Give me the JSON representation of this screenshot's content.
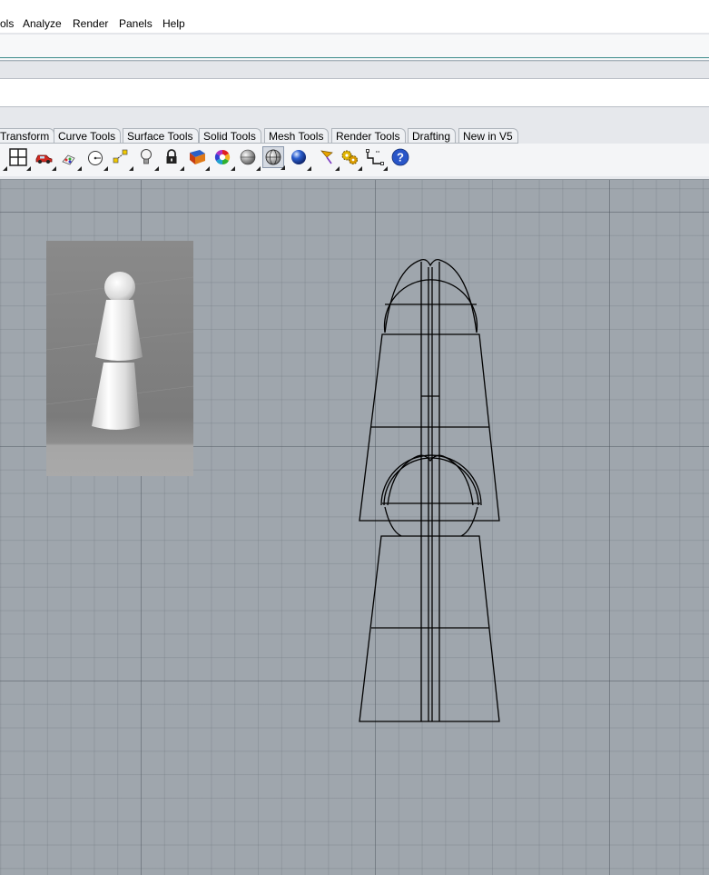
{
  "menu": {
    "items": [
      {
        "label": "ols"
      },
      {
        "label": "Analyze"
      },
      {
        "label": "Render"
      },
      {
        "label": "Panels"
      },
      {
        "label": "Help"
      }
    ]
  },
  "command": {
    "prompt_value": ""
  },
  "tabs": [
    {
      "label": "Transform"
    },
    {
      "label": "Curve Tools"
    },
    {
      "label": "Surface Tools"
    },
    {
      "label": "Solid Tools"
    },
    {
      "label": "Mesh Tools"
    },
    {
      "label": "Render Tools"
    },
    {
      "label": "Drafting"
    },
    {
      "label": "New in V5"
    }
  ],
  "toolbar": {
    "buttons": [
      {
        "icon": "viewport-layout-icon"
      },
      {
        "icon": "car-icon"
      },
      {
        "icon": "paint-icon"
      },
      {
        "icon": "circle-target-icon"
      },
      {
        "icon": "point-select-icon"
      },
      {
        "icon": "lightbulb-icon"
      },
      {
        "icon": "lock-icon"
      },
      {
        "icon": "shaded-box-icon"
      },
      {
        "icon": "color-wheel-icon"
      },
      {
        "icon": "sphere-gray-icon"
      },
      {
        "icon": "sphere-wire-icon"
      },
      {
        "icon": "sphere-blue-icon"
      },
      {
        "icon": "flag-icon"
      },
      {
        "icon": "gear-cluster-icon"
      },
      {
        "icon": "dimension-icon"
      },
      {
        "icon": "help-icon"
      }
    ]
  },
  "colors": {
    "viewport_bg": "#9fa6ad",
    "toolbar_bg": "#e6e8ec",
    "history_rule": "#3d8b8b",
    "wire": "#000000",
    "help_blue": "#2855c8"
  }
}
